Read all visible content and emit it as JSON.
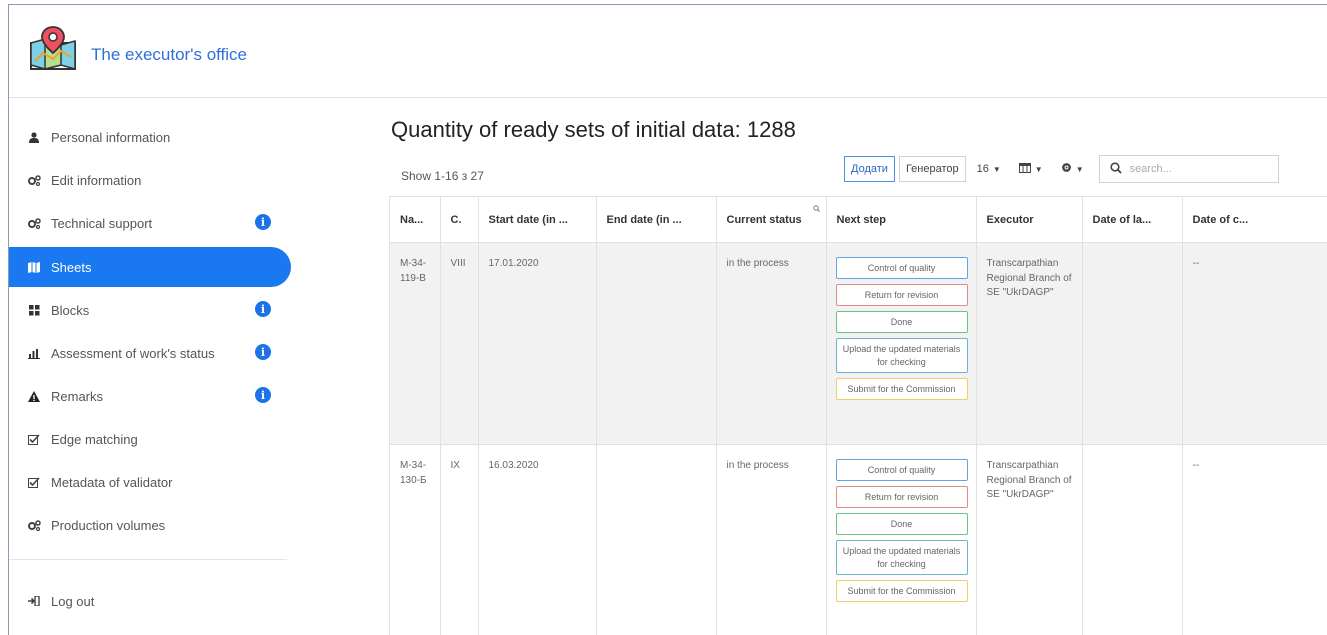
{
  "app": {
    "title": "The executor's office"
  },
  "sidebar": {
    "items": [
      {
        "label": "Personal information",
        "icon": "user-icon",
        "badge": false,
        "active": false
      },
      {
        "label": "Edit information",
        "icon": "gears-icon",
        "badge": false,
        "active": false
      },
      {
        "label": "Technical support",
        "icon": "gears-icon",
        "badge": true,
        "active": false
      },
      {
        "label": "Sheets",
        "icon": "map-icon",
        "badge": false,
        "active": true
      },
      {
        "label": "Blocks",
        "icon": "grid-icon",
        "badge": true,
        "active": false
      },
      {
        "label": "Assessment of work's status",
        "icon": "bar-chart-icon",
        "badge": true,
        "active": false
      },
      {
        "label": "Remarks",
        "icon": "warning-icon",
        "badge": true,
        "active": false
      },
      {
        "label": "Edge matching",
        "icon": "checkbox-icon",
        "badge": false,
        "active": false
      },
      {
        "label": "Metadata of validator",
        "icon": "checkbox-icon",
        "badge": false,
        "active": false
      },
      {
        "label": "Production volumes",
        "icon": "gears-icon",
        "badge": false,
        "active": false
      }
    ],
    "logout": "Log out",
    "badge_symbol": "i"
  },
  "main": {
    "heading": "Quantity of ready sets of initial data:  1288",
    "show_count": "Show 1-16 з 27",
    "toolbar": {
      "add_label": "Додати",
      "generator_label": "Генератор",
      "page_size": "16",
      "search_placeholder": "search..."
    },
    "table": {
      "headers": [
        "Na...",
        "C.",
        "Start date (in ...",
        "End date (in ...",
        "Current status",
        "Next step",
        "Executor",
        "Date of la...",
        "Date of c..."
      ],
      "rows": [
        {
          "name": "M-34-119-B",
          "c": "VIII",
          "start": "17.01.2020",
          "end": "",
          "status": "in the process",
          "executor": "Transcarpathian Regional Branch of SE \"UkrDAGP\"",
          "date_last": "",
          "date_c": "--"
        },
        {
          "name": "M-34-130-Б",
          "c": "IX",
          "start": "16.03.2020",
          "end": "",
          "status": "in the process",
          "executor": "Transcarpathian Regional Branch of SE \"UkrDAGP\"",
          "date_last": "",
          "date_c": "--"
        }
      ],
      "next_steps": [
        "Control of quality",
        "Return for revision",
        "Done",
        "Upload the updated materials for checking",
        "Submit for the Commission"
      ]
    }
  },
  "colors": {
    "accent": "#1a78f0",
    "title": "#2f6fdd",
    "badge": "#1d72e8",
    "step_quality": "#64a4e6",
    "step_return": "#e08a8a",
    "step_done": "#6cc08a",
    "step_upload": "#6fb3c8",
    "step_submit": "#f0cc6a"
  }
}
